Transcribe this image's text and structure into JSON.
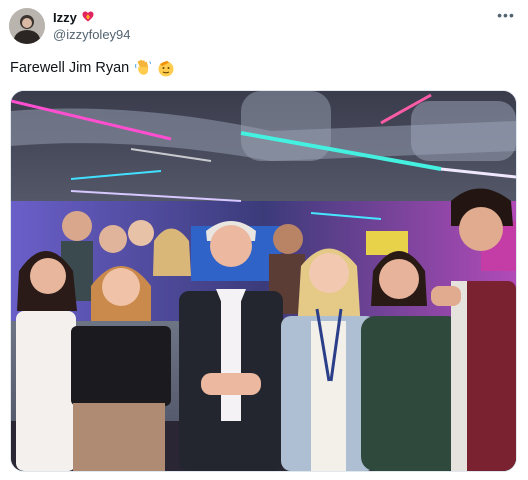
{
  "post": {
    "author_name": "Izzy",
    "author_handle": "@izzyfoley94",
    "text": "Farewell Jim Ryan",
    "text_emojis": [
      "waving-hand-emoji",
      "saluting-face-emoji"
    ],
    "name_badge_icon": "fire-heart-emoji",
    "more_icon": "more-options-icon"
  },
  "media": {
    "type": "photo"
  }
}
